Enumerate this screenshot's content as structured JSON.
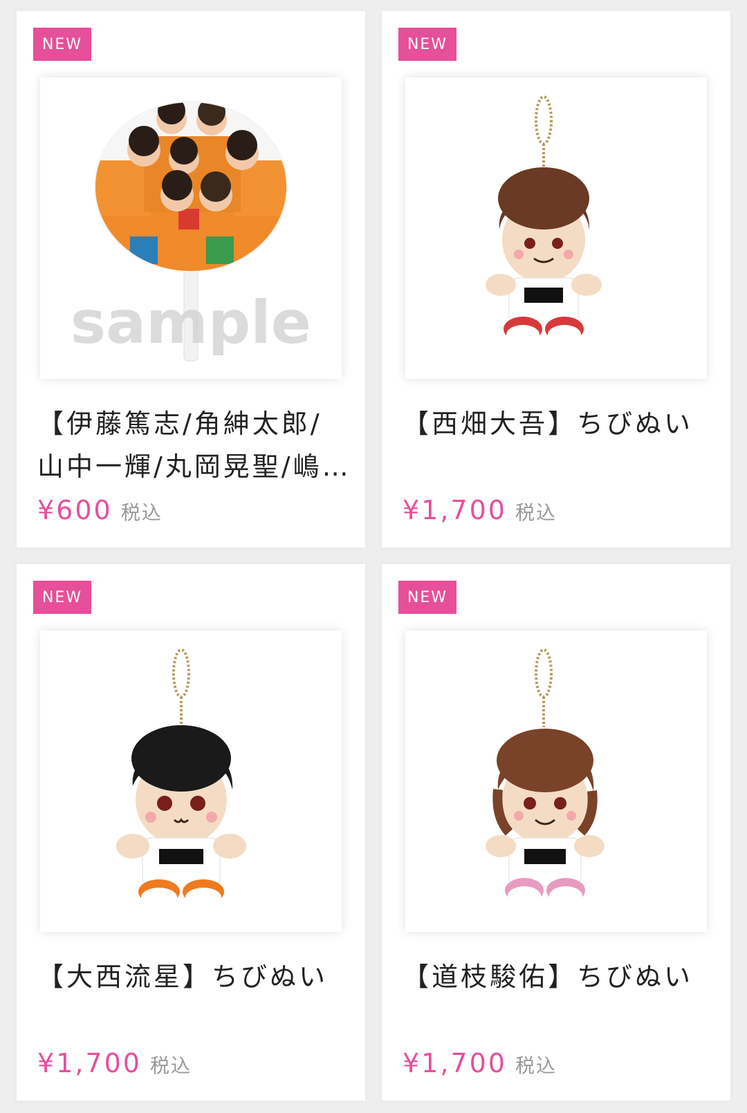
{
  "colors": {
    "accent": "#e64f9a",
    "background": "#eeeeee",
    "text": "#222222",
    "muted": "#999999"
  },
  "products": [
    {
      "badge": "NEW",
      "image_icon": "uchiwa-fan-photo",
      "watermark": "sample",
      "title": "【伊藤篤志/角紳太郎/山中一輝/丸岡晃聖/嶋﨑斗亜/岡佑吏/當間琉巧】うちわ",
      "price": "¥600",
      "tax_label": "税込"
    },
    {
      "badge": "NEW",
      "image_icon": "plush-keychain-brown-hair",
      "title": "【西畑大吾】ちびぬい",
      "price": "¥1,700",
      "tax_label": "税込"
    },
    {
      "badge": "NEW",
      "image_icon": "plush-keychain-black-hair",
      "title": "【大西流星】ちびぬい",
      "price": "¥1,700",
      "tax_label": "税込"
    },
    {
      "badge": "NEW",
      "image_icon": "plush-keychain-brown-wavy-hair",
      "title": "【道枝駿佑】ちびぬい",
      "price": "¥1,700",
      "tax_label": "税込"
    }
  ]
}
